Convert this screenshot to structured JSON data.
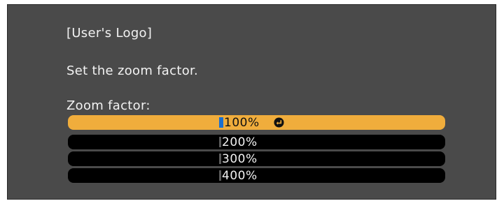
{
  "dialog": {
    "title": "[User's Logo]",
    "instruction": "Set the zoom factor.",
    "field_label": "Zoom factor:"
  },
  "zoom_options": [
    {
      "label": "100%",
      "selected": true,
      "icon": "enter-icon"
    },
    {
      "label": "200%",
      "selected": false
    },
    {
      "label": "300%",
      "selected": false
    },
    {
      "label": "400%",
      "selected": false
    }
  ],
  "colors": {
    "panel_background": "#4a4a4a",
    "highlight": "#f0ad3c",
    "option_background": "#000000",
    "cursor": "#1a6fd0"
  }
}
